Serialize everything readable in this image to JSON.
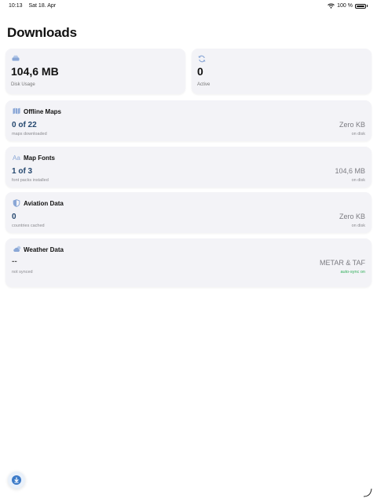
{
  "status_bar": {
    "time": "10:13",
    "date": "Sat 18. Apr",
    "battery": "100 %"
  },
  "page": {
    "title": "Downloads"
  },
  "stats": {
    "disk": {
      "value": "104,6 MB",
      "label": "Disk Usage",
      "icon": "storage-icon"
    },
    "active": {
      "value": "0",
      "label": "Active",
      "icon": "sync-icon"
    }
  },
  "rows": [
    {
      "title": "Offline Maps",
      "count": "0 of 22",
      "sub": "maps downloaded",
      "size": "Zero KB",
      "size_sub": "on disk",
      "icon": "map-icon"
    },
    {
      "title": "Map Fonts",
      "count": "1 of 3",
      "sub": "font packs installed",
      "size": "104,6 MB",
      "size_sub": "on disk",
      "icon": "font-icon"
    },
    {
      "title": "Aviation Data",
      "count": "0",
      "sub": "countries cached",
      "size": "Zero KB",
      "size_sub": "on disk",
      "icon": "shield-icon"
    },
    {
      "title": "Weather Data",
      "count": "--",
      "sub": "not synced",
      "size": "METAR & TAF",
      "size_sub": "auto-sync on",
      "icon": "weather-icon"
    }
  ],
  "colors": {
    "accent": "#3d7bc8",
    "count_text": "#25486f",
    "sync_green": "#2fae58",
    "card_bg": "#f3f3f7"
  }
}
